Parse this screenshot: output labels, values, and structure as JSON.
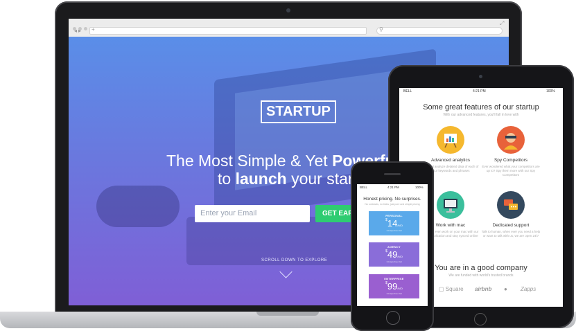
{
  "colors": {
    "accent_green": "#2ecc71",
    "hero_top": "#5a8ee8",
    "hero_bottom": "#7f5fd6",
    "plan_personal": "#5aa9ea",
    "plan_agency": "#8a6dd9",
    "plan_enterprise": "#9a5fd0"
  },
  "laptop": {
    "browser": {
      "back_icon": "back-arrow-icon",
      "forward_icon": "forward-arrow-icon",
      "add_tab_icon": "plus-icon",
      "search_icon": "search-icon"
    },
    "hero": {
      "logo": "STARTUP",
      "headline_1_pre": "The Most Simple & Yet ",
      "headline_1_bold": "Powerful",
      "headline_1_post": " W",
      "headline_2_pre": "to ",
      "headline_2_bold": "launch",
      "headline_2_post": " your startup",
      "email_placeholder": "Enter your Email",
      "cta_label": "GET EARLY",
      "scroll_hint": "SCROLL DOWN TO EXPLORE"
    }
  },
  "tablet": {
    "status": {
      "carrier": "BELL",
      "time": "4:21 PM",
      "battery": "100%"
    },
    "features_title": "Some great features of our startup",
    "features_subtitle": "With our advanced features, you'll fall in love with",
    "features": [
      {
        "title": "Advanced analytics",
        "text": "Get and analyze detailed data of each of your keywords and phrases",
        "icon": "analytics-chart-icon",
        "color": "#f5b82e"
      },
      {
        "title": "Spy Competitors",
        "text": "Ever wondered what your competitors are up to? Spy them more with our Spy Competitors",
        "icon": "spy-person-icon",
        "color": "#e8623a"
      },
      {
        "title": "Work with mac",
        "text": "You can even work on your mac with our easy application and stay synced online",
        "icon": "monitor-icon",
        "color": "#3bbf9c"
      },
      {
        "title": "Dedicated support",
        "text": "Talk to human, when ever you need a help or want to talk with us, we are open 24/7",
        "icon": "chat-bubbles-icon",
        "color": "#34495e"
      }
    ],
    "company_title": "You are in a good company",
    "company_subtitle": "We are funded with world's trusted brands",
    "logos": [
      "Square",
      "airbnb",
      "Zapps"
    ]
  },
  "phone": {
    "status": {
      "carrier": "BELL",
      "time": "4:21 PM",
      "battery": "100%"
    },
    "title": "Honest pricing. No surprises.",
    "subtitle": "No contracts, no tricks, just pure and simple pricing",
    "plans": [
      {
        "name": "PERSONAL",
        "currency": "$",
        "price": "14",
        "unit": "/MO",
        "note": "14 days free trial"
      },
      {
        "name": "AGENCY",
        "currency": "$",
        "price": "49",
        "unit": "/MO",
        "note": "14 days free trial"
      },
      {
        "name": "ENTERPRISE",
        "currency": "$",
        "price": "99",
        "unit": "/MO",
        "note": "14 days free trial"
      }
    ]
  }
}
